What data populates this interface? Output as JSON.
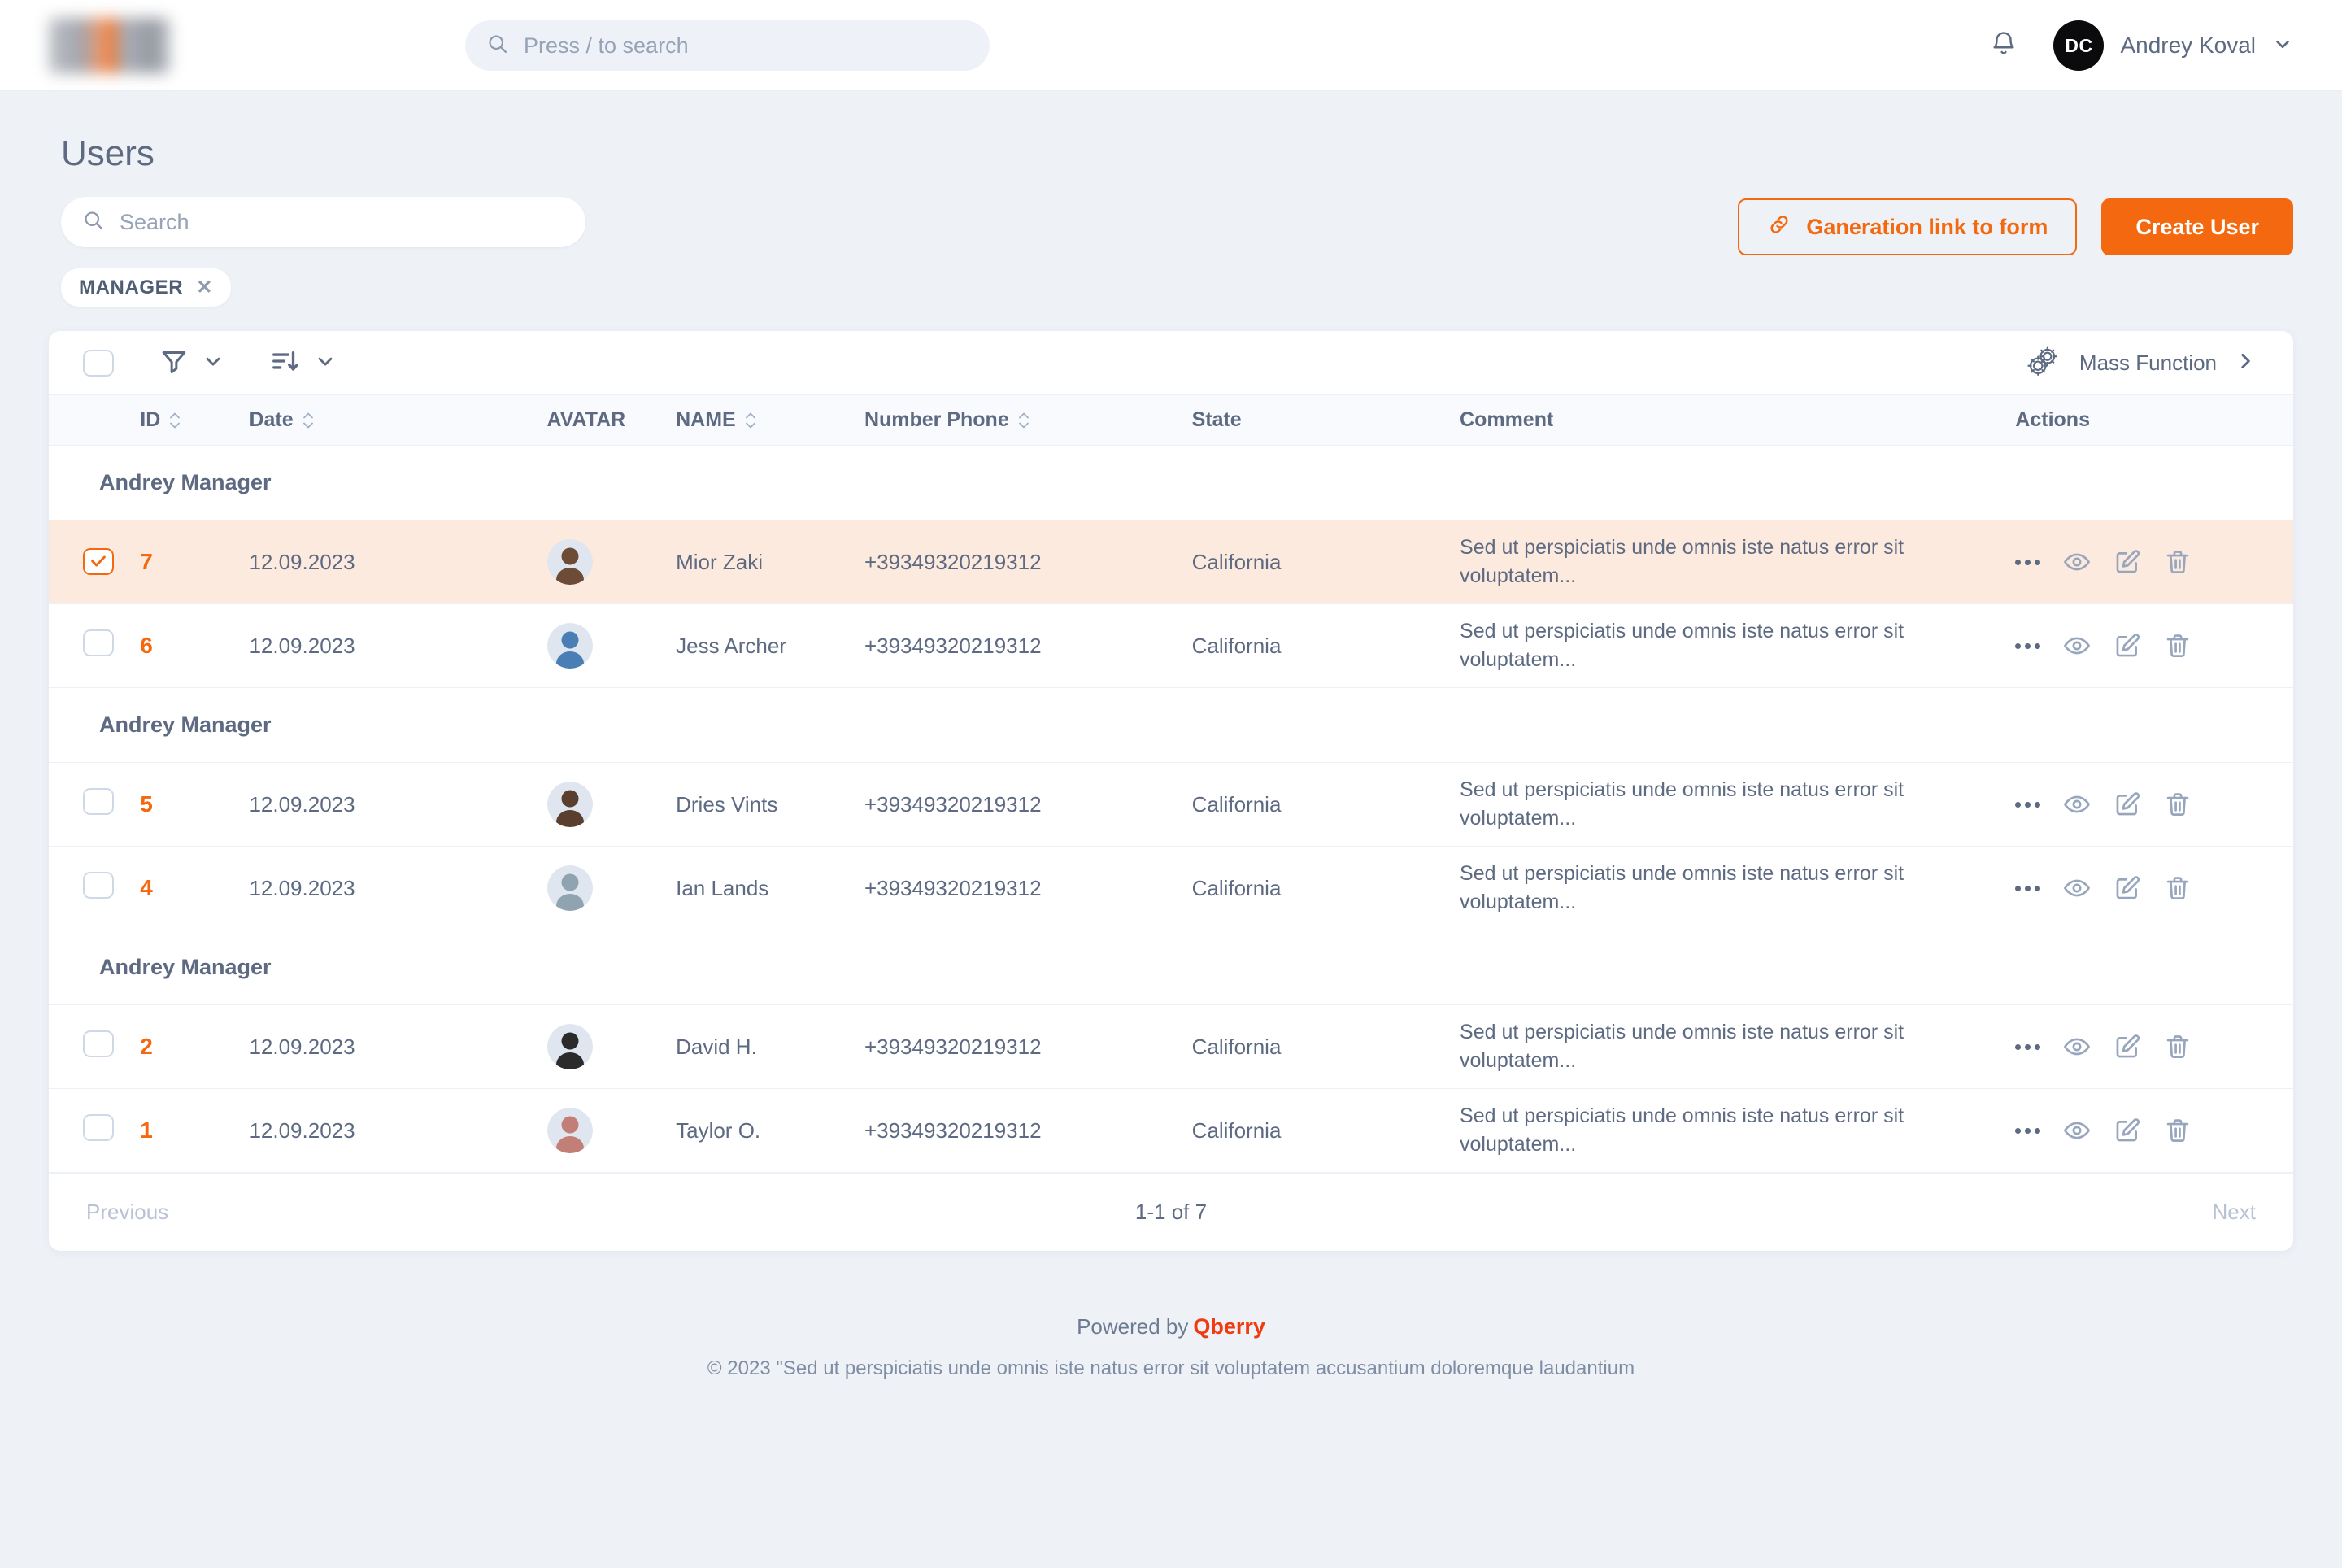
{
  "topbar": {
    "logo_alt": "company-logo",
    "search_placeholder": "Press / to search",
    "search_value": "",
    "bell_icon": "bell-icon",
    "user": {
      "initials": "DC",
      "name": "Andrey Koval",
      "chevron_icon": "chevron-down-icon"
    }
  },
  "header": {
    "title": "Users",
    "search_placeholder": "Search",
    "search_value": "",
    "generate_link_label": "Ganeration link to form",
    "generate_link_icon": "link-icon",
    "create_user_label": "Create User",
    "accent_color": "#f4690f"
  },
  "filters": {
    "chips": [
      {
        "label": "MANAGER",
        "remove_icon": "close-icon"
      }
    ]
  },
  "toolbar": {
    "select_all_checked": false,
    "filter_icon": "funnel-icon",
    "filter_chevron_icon": "chevron-down-icon",
    "sort_icon": "sort-descending-icon",
    "sort_chevron_icon": "chevron-down-icon",
    "mass_function_label": "Mass Function",
    "mass_function_icon": "gears-icon",
    "mass_function_chevron_icon": "chevron-right-icon"
  },
  "table": {
    "columns": [
      {
        "key": "check",
        "label": "",
        "sortable": false
      },
      {
        "key": "id",
        "label": "ID",
        "sortable": true
      },
      {
        "key": "date",
        "label": "Date",
        "sortable": true
      },
      {
        "key": "avatar",
        "label": "AVATAR",
        "sortable": false
      },
      {
        "key": "name",
        "label": "NAME",
        "sortable": true
      },
      {
        "key": "phone",
        "label": "Number Phone",
        "sortable": true
      },
      {
        "key": "state",
        "label": "State",
        "sortable": false
      },
      {
        "key": "comment",
        "label": "Comment",
        "sortable": false
      },
      {
        "key": "actions",
        "label": "Actions",
        "sortable": false
      }
    ],
    "groups": [
      {
        "label": "Andrey Manager",
        "rows": [
          {
            "selected": true,
            "id": "7",
            "date": "12.09.2023",
            "avatar_tone": "#6d4c37",
            "name": "Mior Zaki",
            "phone": "+39349320219312",
            "state": "California",
            "comment": "Sed ut perspiciatis unde omnis iste natus error sit voluptatem..."
          },
          {
            "selected": false,
            "id": "6",
            "date": "12.09.2023",
            "avatar_tone": "#4a7fb5",
            "name": "Jess Archer",
            "phone": "+39349320219312",
            "state": "California",
            "comment": "Sed ut perspiciatis unde omnis iste natus error sit voluptatem..."
          }
        ]
      },
      {
        "label": "Andrey Manager",
        "rows": [
          {
            "selected": false,
            "id": "5",
            "date": "12.09.2023",
            "avatar_tone": "#5a3f2e",
            "name": "Dries Vints",
            "phone": "+39349320219312",
            "state": "California",
            "comment": "Sed ut perspiciatis unde omnis iste natus error sit voluptatem..."
          },
          {
            "selected": false,
            "id": "4",
            "date": "12.09.2023",
            "avatar_tone": "#8fa3b0",
            "name": "Ian Lands",
            "phone": "+39349320219312",
            "state": "California",
            "comment": "Sed ut perspiciatis unde omnis iste natus error sit voluptatem..."
          }
        ]
      },
      {
        "label": "Andrey Manager",
        "rows": [
          {
            "selected": false,
            "id": "2",
            "date": "12.09.2023",
            "avatar_tone": "#2b2b2b",
            "name": "David H.",
            "phone": "+39349320219312",
            "state": "California",
            "comment": "Sed ut perspiciatis unde omnis iste natus error sit voluptatem..."
          },
          {
            "selected": false,
            "id": "1",
            "date": "12.09.2023",
            "avatar_tone": "#c27f77",
            "name": "Taylor O.",
            "phone": "+39349320219312",
            "state": "California",
            "comment": "Sed ut perspiciatis unde omnis iste natus error sit voluptatem..."
          }
        ]
      }
    ],
    "row_actions": [
      {
        "icon": "more-options-icon",
        "name": "more-options"
      },
      {
        "icon": "eye-icon",
        "name": "view"
      },
      {
        "icon": "edit-icon",
        "name": "edit"
      },
      {
        "icon": "trash-icon",
        "name": "delete"
      }
    ]
  },
  "pagination": {
    "previous_label": "Previous",
    "range_label": "1-1 of 7",
    "next_label": "Next"
  },
  "footer": {
    "powered_by_prefix": "Powered by",
    "brand": "Qberry",
    "copyright": "© 2023 \"Sed ut perspiciatis unde omnis iste natus error sit voluptatem accusantium doloremque laudantium"
  }
}
